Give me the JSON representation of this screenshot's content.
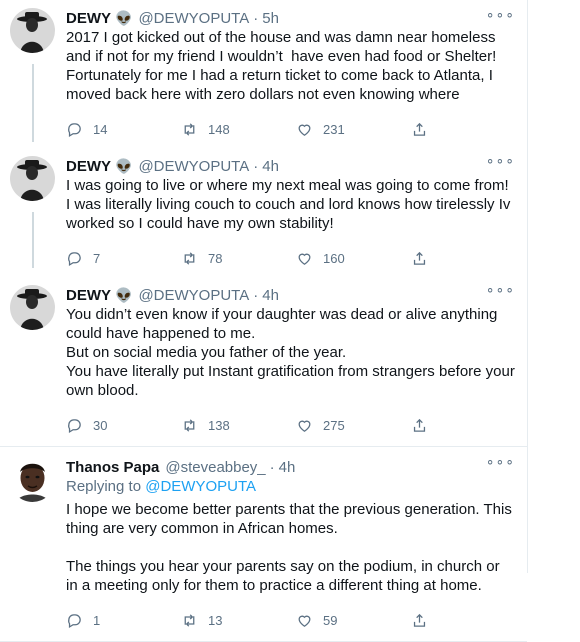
{
  "tweets": [
    {
      "name": "DEWY",
      "badge": "👽",
      "handle": "@DEWYOPUTA",
      "time": "5h",
      "replying_label": "",
      "replying_to": "",
      "lines": [
        "2017 I got kicked out of the house and was damn near homeless and if not for my friend I wouldn’t  have even had food or Shelter!",
        "Fortunately for me I had a return ticket to come back to Atlanta, I moved back here with zero dollars not even knowing where"
      ],
      "replies": "14",
      "retweets": "148",
      "likes": "231"
    },
    {
      "name": "DEWY",
      "badge": "👽",
      "handle": "@DEWYOPUTA",
      "time": "4h",
      "replying_label": "",
      "replying_to": "",
      "lines": [
        "I was going to live or where my next meal was going to come from!",
        "I was literally living couch to couch and lord knows how tirelessly Iv worked so I could have my own stability!"
      ],
      "replies": "7",
      "retweets": "78",
      "likes": "160"
    },
    {
      "name": "DEWY",
      "badge": "👽",
      "handle": "@DEWYOPUTA",
      "time": "4h",
      "replying_label": "",
      "replying_to": "",
      "lines": [
        "You didn’t even know if your daughter was dead or alive anything could have happened to me.",
        "But on social media you father of the year.",
        "You have literally put Instant gratification from strangers before your own blood."
      ],
      "replies": "30",
      "retweets": "138",
      "likes": "275"
    },
    {
      "name": "Thanos Papa",
      "badge": "",
      "handle": "@steveabbey_",
      "time": "4h",
      "replying_label": "Replying to",
      "replying_to": "@DEWYOPUTA",
      "lines": [
        "I hope we become better parents that the previous generation. This thing are very common in African homes.",
        "",
        "The things you hear your parents say on the podium, in church or in a meeting only for them to practice a different thing at home."
      ],
      "replies": "1",
      "retweets": "13",
      "likes": "59"
    }
  ],
  "icons": {
    "reply": "reply-icon",
    "retweet": "retweet-icon",
    "like": "heart-icon",
    "share": "share-icon",
    "more": "more-icon"
  },
  "colors": {
    "link": "#1da1f2",
    "muted": "#5b7083",
    "divider": "#e6ecf0"
  }
}
